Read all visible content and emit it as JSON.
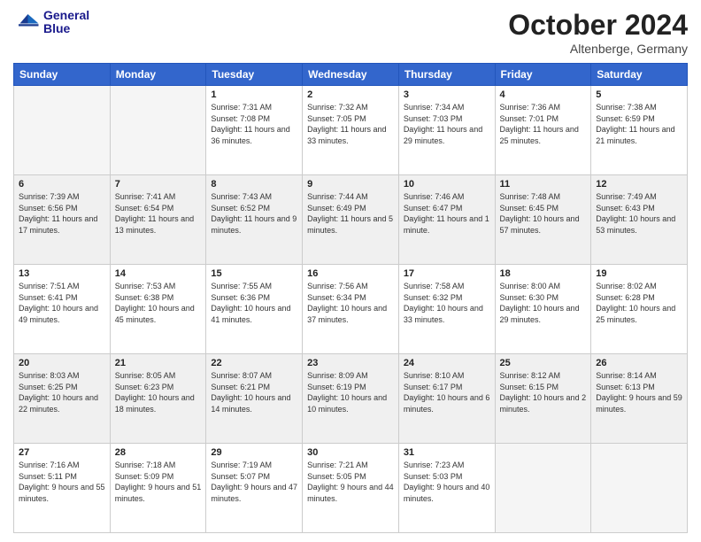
{
  "header": {
    "logo_line1": "General",
    "logo_line2": "Blue",
    "month": "October 2024",
    "location": "Altenberge, Germany"
  },
  "days_of_week": [
    "Sunday",
    "Monday",
    "Tuesday",
    "Wednesday",
    "Thursday",
    "Friday",
    "Saturday"
  ],
  "weeks": [
    [
      {
        "day": "",
        "info": ""
      },
      {
        "day": "",
        "info": ""
      },
      {
        "day": "1",
        "info": "Sunrise: 7:31 AM\nSunset: 7:08 PM\nDaylight: 11 hours and 36 minutes."
      },
      {
        "day": "2",
        "info": "Sunrise: 7:32 AM\nSunset: 7:05 PM\nDaylight: 11 hours and 33 minutes."
      },
      {
        "day": "3",
        "info": "Sunrise: 7:34 AM\nSunset: 7:03 PM\nDaylight: 11 hours and 29 minutes."
      },
      {
        "day": "4",
        "info": "Sunrise: 7:36 AM\nSunset: 7:01 PM\nDaylight: 11 hours and 25 minutes."
      },
      {
        "day": "5",
        "info": "Sunrise: 7:38 AM\nSunset: 6:59 PM\nDaylight: 11 hours and 21 minutes."
      }
    ],
    [
      {
        "day": "6",
        "info": "Sunrise: 7:39 AM\nSunset: 6:56 PM\nDaylight: 11 hours and 17 minutes."
      },
      {
        "day": "7",
        "info": "Sunrise: 7:41 AM\nSunset: 6:54 PM\nDaylight: 11 hours and 13 minutes."
      },
      {
        "day": "8",
        "info": "Sunrise: 7:43 AM\nSunset: 6:52 PM\nDaylight: 11 hours and 9 minutes."
      },
      {
        "day": "9",
        "info": "Sunrise: 7:44 AM\nSunset: 6:49 PM\nDaylight: 11 hours and 5 minutes."
      },
      {
        "day": "10",
        "info": "Sunrise: 7:46 AM\nSunset: 6:47 PM\nDaylight: 11 hours and 1 minute."
      },
      {
        "day": "11",
        "info": "Sunrise: 7:48 AM\nSunset: 6:45 PM\nDaylight: 10 hours and 57 minutes."
      },
      {
        "day": "12",
        "info": "Sunrise: 7:49 AM\nSunset: 6:43 PM\nDaylight: 10 hours and 53 minutes."
      }
    ],
    [
      {
        "day": "13",
        "info": "Sunrise: 7:51 AM\nSunset: 6:41 PM\nDaylight: 10 hours and 49 minutes."
      },
      {
        "day": "14",
        "info": "Sunrise: 7:53 AM\nSunset: 6:38 PM\nDaylight: 10 hours and 45 minutes."
      },
      {
        "day": "15",
        "info": "Sunrise: 7:55 AM\nSunset: 6:36 PM\nDaylight: 10 hours and 41 minutes."
      },
      {
        "day": "16",
        "info": "Sunrise: 7:56 AM\nSunset: 6:34 PM\nDaylight: 10 hours and 37 minutes."
      },
      {
        "day": "17",
        "info": "Sunrise: 7:58 AM\nSunset: 6:32 PM\nDaylight: 10 hours and 33 minutes."
      },
      {
        "day": "18",
        "info": "Sunrise: 8:00 AM\nSunset: 6:30 PM\nDaylight: 10 hours and 29 minutes."
      },
      {
        "day": "19",
        "info": "Sunrise: 8:02 AM\nSunset: 6:28 PM\nDaylight: 10 hours and 25 minutes."
      }
    ],
    [
      {
        "day": "20",
        "info": "Sunrise: 8:03 AM\nSunset: 6:25 PM\nDaylight: 10 hours and 22 minutes."
      },
      {
        "day": "21",
        "info": "Sunrise: 8:05 AM\nSunset: 6:23 PM\nDaylight: 10 hours and 18 minutes."
      },
      {
        "day": "22",
        "info": "Sunrise: 8:07 AM\nSunset: 6:21 PM\nDaylight: 10 hours and 14 minutes."
      },
      {
        "day": "23",
        "info": "Sunrise: 8:09 AM\nSunset: 6:19 PM\nDaylight: 10 hours and 10 minutes."
      },
      {
        "day": "24",
        "info": "Sunrise: 8:10 AM\nSunset: 6:17 PM\nDaylight: 10 hours and 6 minutes."
      },
      {
        "day": "25",
        "info": "Sunrise: 8:12 AM\nSunset: 6:15 PM\nDaylight: 10 hours and 2 minutes."
      },
      {
        "day": "26",
        "info": "Sunrise: 8:14 AM\nSunset: 6:13 PM\nDaylight: 9 hours and 59 minutes."
      }
    ],
    [
      {
        "day": "27",
        "info": "Sunrise: 7:16 AM\nSunset: 5:11 PM\nDaylight: 9 hours and 55 minutes."
      },
      {
        "day": "28",
        "info": "Sunrise: 7:18 AM\nSunset: 5:09 PM\nDaylight: 9 hours and 51 minutes."
      },
      {
        "day": "29",
        "info": "Sunrise: 7:19 AM\nSunset: 5:07 PM\nDaylight: 9 hours and 47 minutes."
      },
      {
        "day": "30",
        "info": "Sunrise: 7:21 AM\nSunset: 5:05 PM\nDaylight: 9 hours and 44 minutes."
      },
      {
        "day": "31",
        "info": "Sunrise: 7:23 AM\nSunset: 5:03 PM\nDaylight: 9 hours and 40 minutes."
      },
      {
        "day": "",
        "info": ""
      },
      {
        "day": "",
        "info": ""
      }
    ]
  ]
}
